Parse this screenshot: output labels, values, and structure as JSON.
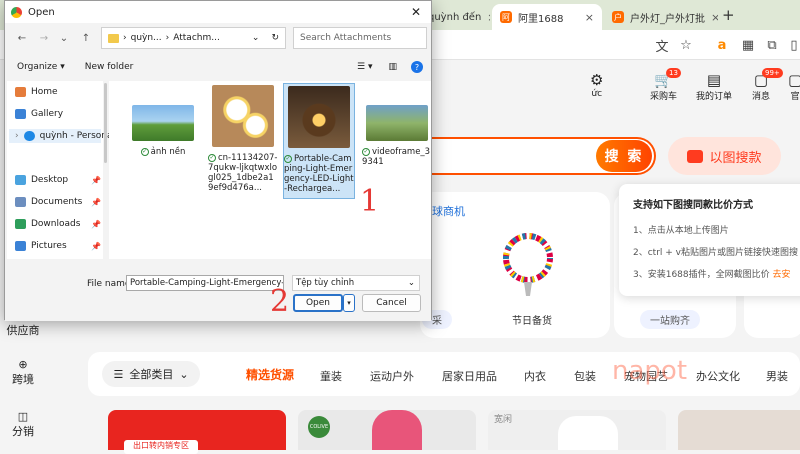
{
  "browser": {
    "tabs": [
      {
        "label": "quỳnh đến"
      },
      {
        "label": "阿里1688",
        "active": true
      },
      {
        "label": "户外灯_户外灯批"
      }
    ],
    "new_tab": "+",
    "close": "×"
  },
  "site": {
    "nav": [
      {
        "label": "ức"
      },
      {
        "label": "采购车",
        "badge": "13"
      },
      {
        "label": "我的订单"
      },
      {
        "label": "消息",
        "badge": "99+"
      },
      {
        "label": "官"
      }
    ],
    "search_button": "搜 索",
    "image_search": "以图搜款",
    "section_label": "球商机",
    "product_caption": "节日备货",
    "pill_left": "采",
    "pill_right": "一站购齐",
    "tooltip": {
      "title": "支持如下图搜同款比价方式",
      "lines": [
        "1、点击从本地上传图片",
        "2、ctrl + v粘贴图片或图片链接快速图搜",
        "3、安装1688插件，全网截图比价"
      ],
      "link": "去安"
    },
    "left_nav": [
      {
        "label": "供应商"
      },
      {
        "label": "跨境"
      },
      {
        "label": "分销"
      }
    ],
    "categories": {
      "all": "全部类目",
      "active": "精选货源",
      "items": [
        "童装",
        "运动户外",
        "居家日用品",
        "内衣",
        "包装",
        "宠物园艺",
        "办公文化",
        "男装"
      ]
    },
    "watermark": "napot",
    "card_text": "出口转内销专区",
    "brand_tag": "COLIVE",
    "card3_text": "宽闲"
  },
  "dialog": {
    "title": "Open",
    "path": [
      "quỳn...",
      "Attachm..."
    ],
    "search_placeholder": "Search Attachments",
    "organize": "Organize",
    "new_folder": "New folder",
    "nav": [
      {
        "label": "Home"
      },
      {
        "label": "Gallery"
      },
      {
        "label": "quỳnh - Persona"
      },
      {
        "label": "Desktop"
      },
      {
        "label": "Documents"
      },
      {
        "label": "Downloads"
      },
      {
        "label": "Pictures"
      }
    ],
    "files": [
      {
        "name": "ảnh nền"
      },
      {
        "name": "cn-11134207-7qukw-ljkqtwxlogl025_1dbe2a19ef9d476a..."
      },
      {
        "name": "Portable-Camping-Light-Emergency-LED-Light-Rechargea..."
      },
      {
        "name": "videoframe_39341"
      }
    ],
    "file_name_label": "File name:",
    "file_name_value": "Portable-Camping-Light-Emergency-LED",
    "file_type": "Tệp tùy chỉnh",
    "open": "Open",
    "cancel": "Cancel"
  },
  "annotations": [
    "1",
    "2"
  ],
  "colors": {
    "accent": "#ff6a00",
    "dialog_select": "#cce4f7",
    "annotation": "#e53935"
  }
}
